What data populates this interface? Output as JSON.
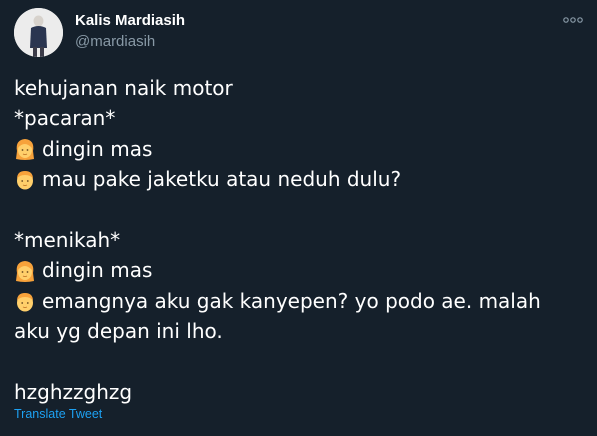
{
  "author": {
    "name": "Kalis Mardiasih",
    "handle": "@mardiasih",
    "avatar_icon": "profile-photo"
  },
  "more_icon": "more-options-icon",
  "tweet": {
    "lines": [
      {
        "text": "kehujanan naik motor"
      },
      {
        "text": "*pacaran*"
      },
      {
        "emoji": "woman-icon",
        "text": "dingin mas"
      },
      {
        "emoji": "man-icon",
        "text": "mau pake jaketku atau neduh dulu?"
      },
      {
        "text": ""
      },
      {
        "text": "*menikah*"
      },
      {
        "emoji": "woman-icon",
        "text": "dingin mas"
      },
      {
        "emoji": "man-icon",
        "text": "emangnya aku gak kanyepen? yo podo ae. malah"
      },
      {
        "text": "aku yg depan ini lho."
      },
      {
        "text": ""
      },
      {
        "text": "hzghzzghzg"
      }
    ]
  },
  "translate_label": "Translate Tweet",
  "colors": {
    "background": "#15202b",
    "text": "#ffffff",
    "secondary": "#8899a6",
    "link": "#1da1f2"
  }
}
